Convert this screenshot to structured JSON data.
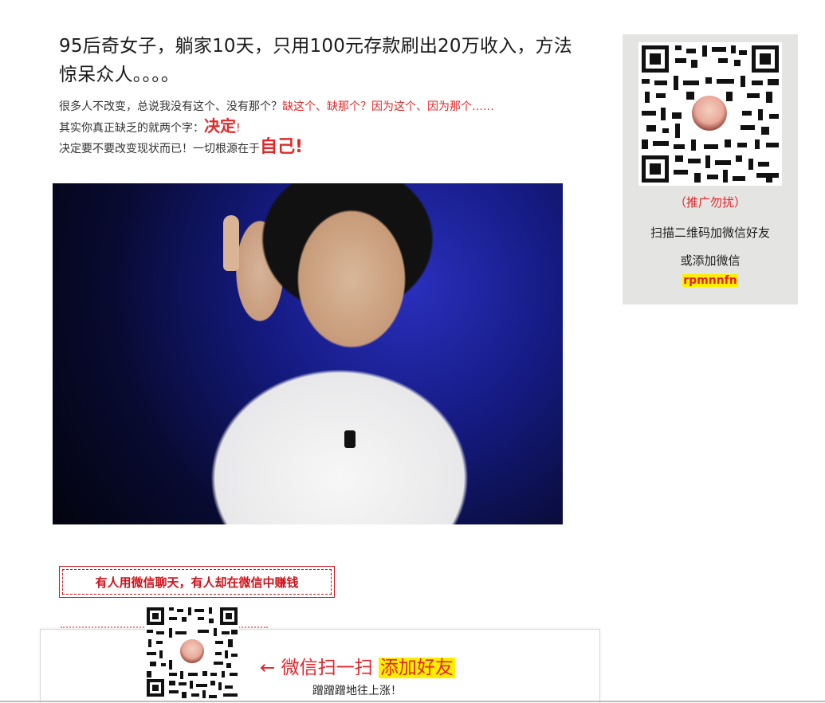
{
  "article": {
    "headline": "95后奇女子，躺家10天，只用100元存款刷出20万收入，方法惊呆众人。。。。",
    "line1_prefix": "很多人不改变，总说我没有这个、没有那个？",
    "line1_red": "缺这个、缺那个？因为这个、因为那个……",
    "line2_prefix": "其实你真正缺乏的就两个字：",
    "line2_big": "决定",
    "line2_suffix": "!",
    "line3_prefix": "决定要不要改变现状而已！一切根源在于",
    "line3_big": "自己",
    "line3_suffix": "!"
  },
  "slogan": "有人用微信聊天，有人却在微信中赚钱",
  "sidebar": {
    "promo_note": "（推广勿扰）",
    "scan_text": "扫描二维码加微信好友",
    "or_text": "或添加微信",
    "wechat_id": "rpmnnfn"
  },
  "bottom_bar": {
    "arrow": "←",
    "scan_label": "微信扫一扫",
    "add_friend": "添加好友",
    "sub_text": "蹭蹭蹭地往上涨！"
  },
  "colors": {
    "accent_red": "#e0242a",
    "highlight_yellow": "#ffee00",
    "sidebar_bg": "#e4e4e2"
  },
  "icons": {
    "qr": "qr-code-icon",
    "avatar": "avatar-image"
  }
}
